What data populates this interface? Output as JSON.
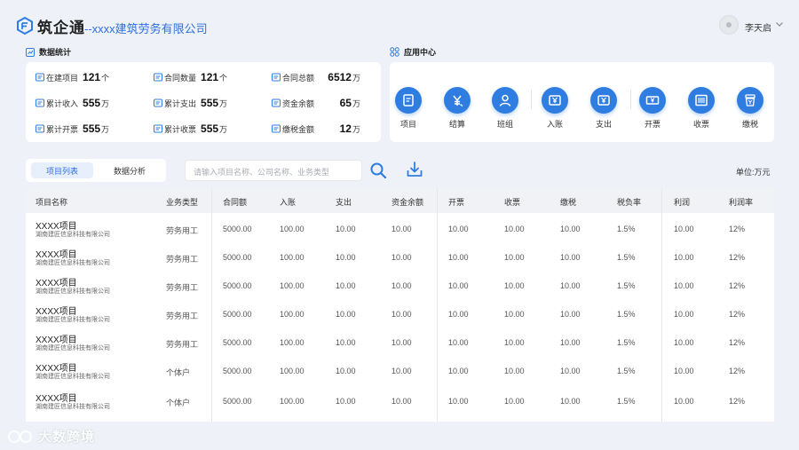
{
  "header": {
    "app_name": "筑企通",
    "company": "--xxxx建筑劳务有限公司",
    "user_name": "李天启"
  },
  "stats": {
    "title": "数据统计",
    "items": [
      {
        "label": "在建项目",
        "value": "121",
        "unit": "个"
      },
      {
        "label": "合同数量",
        "value": "121",
        "unit": "个"
      },
      {
        "label": "合同总额",
        "value": "6512",
        "unit": "万"
      },
      {
        "label": "累计收入",
        "value": "555",
        "unit": "万"
      },
      {
        "label": "累计支出",
        "value": "555",
        "unit": "万"
      },
      {
        "label": "资金余额",
        "value": "65",
        "unit": "万"
      },
      {
        "label": "累计开票",
        "value": "555",
        "unit": "万"
      },
      {
        "label": "累计收票",
        "value": "555",
        "unit": "万"
      },
      {
        "label": "缴税金额",
        "value": "12",
        "unit": "万"
      }
    ]
  },
  "apps": {
    "title": "应用中心",
    "items": [
      {
        "label": "项目",
        "icon": "document-icon"
      },
      {
        "label": "结算",
        "icon": "yuan-settle-icon"
      },
      {
        "label": "班组",
        "icon": "person-icon"
      },
      {
        "label": "入账",
        "icon": "income-icon"
      },
      {
        "label": "支出",
        "icon": "expense-icon"
      },
      {
        "label": "开票",
        "icon": "invoice-icon"
      },
      {
        "label": "收票",
        "icon": "receipt-icon"
      },
      {
        "label": "缴税",
        "icon": "tax-icon"
      }
    ]
  },
  "tabs": [
    {
      "label": "项目列表",
      "active": true
    },
    {
      "label": "数据分析",
      "active": false
    }
  ],
  "search": {
    "placeholder": "请输入项目名称、公司名称、业务类型"
  },
  "unit_label": "单位:万元",
  "table": {
    "columns": [
      "项目名称",
      "业务类型",
      "合同额",
      "入账",
      "支出",
      "资金余额",
      "开票",
      "收票",
      "缴税",
      "税负率",
      "利润",
      "利润率"
    ],
    "rows": [
      {
        "name": "XXXX项目",
        "company": "湖南建匠信息科技有限公司",
        "type": "劳务用工",
        "contract": "5000.00",
        "income": "100.00",
        "expense": "10.00",
        "balance": "10.00",
        "invoice": "10.00",
        "receipt": "10.00",
        "tax": "10.00",
        "tax_rate": "1.5%",
        "profit": "10.00",
        "profit_rate": "12%"
      },
      {
        "name": "XXXX项目",
        "company": "湖南建匠信息科技有限公司",
        "type": "劳务用工",
        "contract": "5000.00",
        "income": "100.00",
        "expense": "10.00",
        "balance": "10.00",
        "invoice": "10.00",
        "receipt": "10.00",
        "tax": "10.00",
        "tax_rate": "1.5%",
        "profit": "10.00",
        "profit_rate": "12%"
      },
      {
        "name": "XXXX项目",
        "company": "湖南建匠信息科技有限公司",
        "type": "劳务用工",
        "contract": "5000.00",
        "income": "100.00",
        "expense": "10.00",
        "balance": "10.00",
        "invoice": "10.00",
        "receipt": "10.00",
        "tax": "10.00",
        "tax_rate": "1.5%",
        "profit": "10.00",
        "profit_rate": "12%"
      },
      {
        "name": "XXXX项目",
        "company": "湖南建匠信息科技有限公司",
        "type": "劳务用工",
        "contract": "5000.00",
        "income": "100.00",
        "expense": "10.00",
        "balance": "10.00",
        "invoice": "10.00",
        "receipt": "10.00",
        "tax": "10.00",
        "tax_rate": "1.5%",
        "profit": "10.00",
        "profit_rate": "12%"
      },
      {
        "name": "XXXX项目",
        "company": "湖南建匠信息科技有限公司",
        "type": "劳务用工",
        "contract": "5000.00",
        "income": "100.00",
        "expense": "10.00",
        "balance": "10.00",
        "invoice": "10.00",
        "receipt": "10.00",
        "tax": "10.00",
        "tax_rate": "1.5%",
        "profit": "10.00",
        "profit_rate": "12%"
      },
      {
        "name": "XXXX项目",
        "company": "湖南建匠信息科技有限公司",
        "type": "个体户",
        "contract": "5000.00",
        "income": "100.00",
        "expense": "10.00",
        "balance": "10.00",
        "invoice": "10.00",
        "receipt": "10.00",
        "tax": "10.00",
        "tax_rate": "1.5%",
        "profit": "10.00",
        "profit_rate": "12%"
      },
      {
        "name": "XXXX项目",
        "company": "湖南建匠信息科技有限公司",
        "type": "个体户",
        "contract": "5000.00",
        "income": "100.00",
        "expense": "10.00",
        "balance": "10.00",
        "invoice": "10.00",
        "receipt": "10.00",
        "tax": "10.00",
        "tax_rate": "1.5%",
        "profit": "10.00",
        "profit_rate": "12%"
      }
    ]
  },
  "watermark": {
    "text": "大数跨境"
  },
  "colors": {
    "accent": "#2f7de1",
    "brand_text": "#2f6fe0",
    "background": "#eef2f8"
  }
}
